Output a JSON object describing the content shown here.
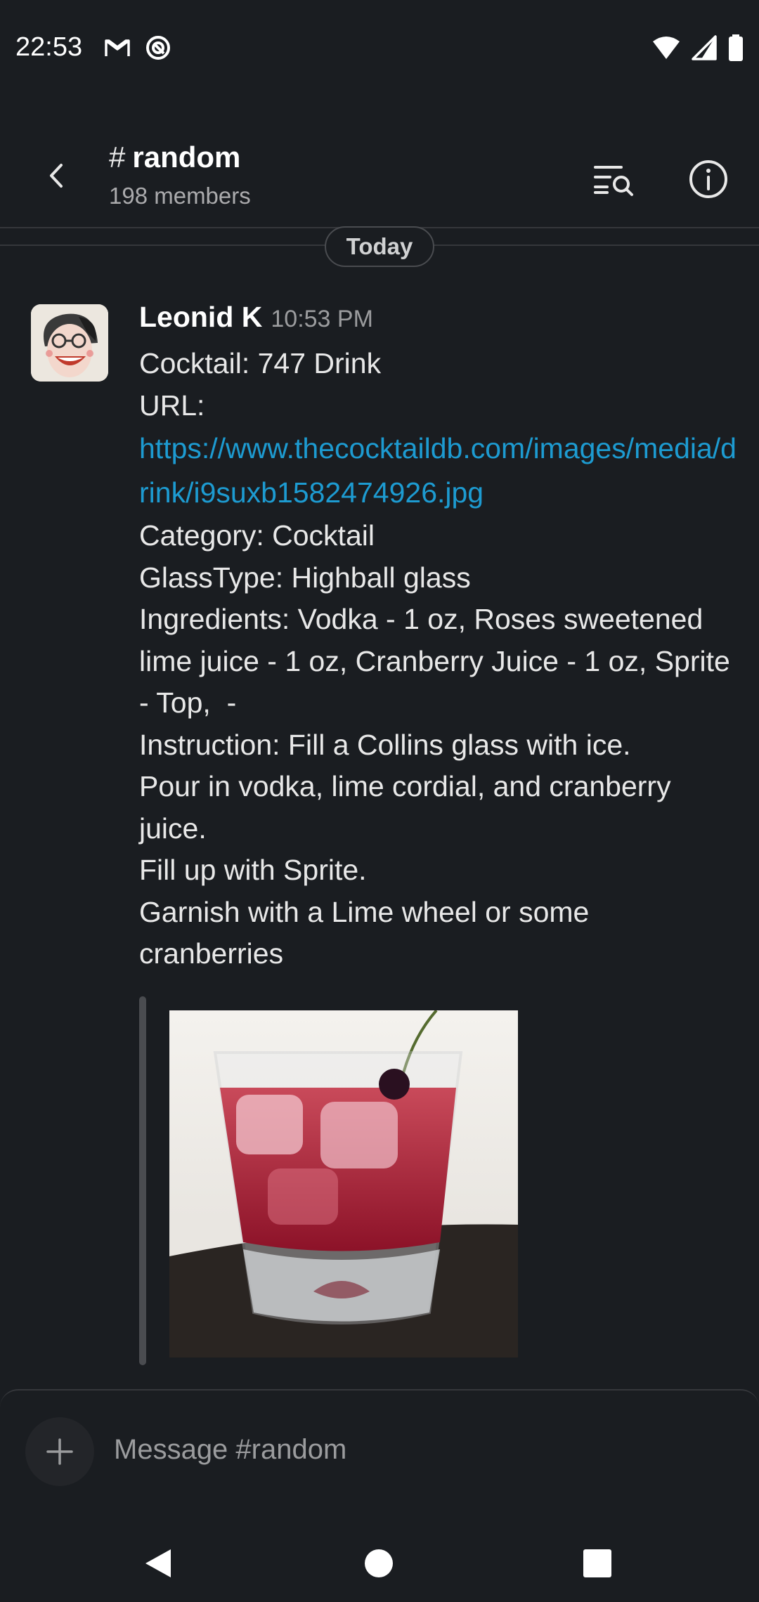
{
  "status_bar": {
    "time": "22:53",
    "left_icons": [
      "gmail-icon",
      "sync-icon"
    ],
    "right_icons": [
      "wifi-icon",
      "signal-icon",
      "battery-icon"
    ]
  },
  "header": {
    "hash": "#",
    "channel_name": "random",
    "members": "198 members",
    "icons": [
      "back-icon",
      "search-in-channel-icon",
      "info-icon"
    ]
  },
  "date_divider": "Today",
  "message": {
    "author": "Leonid K",
    "time": "10:53 PM",
    "line_cocktail": "Cocktail: 747 Drink",
    "line_url_label": "URL:",
    "url": "https://www.thecocktaildb.com/images/media/drink/i9suxb1582474926.jpg",
    "line_category": "Category: Cocktail",
    "line_glass": "GlassType: Highball glass",
    "line_ingredients": "Ingredients: Vodka - 1 oz, Roses sweetened lime juice - 1 oz, Cranberry Juice - 1 oz, Sprite - Top,  -",
    "line_instruction": "Instruction: Fill a Collins glass with ice.\nPour in vodka, lime cordial, and cranberry juice.\nFill up with Sprite.\nGarnish with a Lime wheel or some cranberries"
  },
  "composer": {
    "placeholder": "Message #random"
  },
  "colors": {
    "background": "#1a1d21",
    "link": "#1d9bd1",
    "text": "#e8e8e8",
    "muted": "#9b9c9e"
  }
}
